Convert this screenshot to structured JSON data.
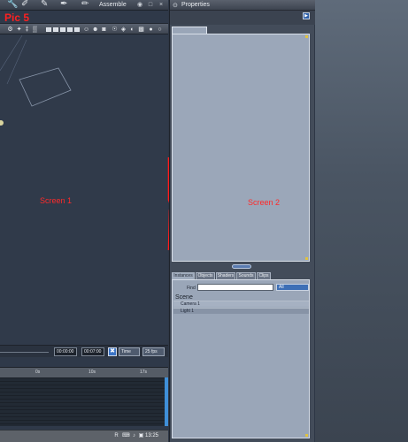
{
  "annotation": {
    "pic_label": "Pic 5",
    "screen1_label": "Screen 1",
    "screen2_label": "Screen 2",
    "color": "#ff2020"
  },
  "assemble": {
    "title": "Assemble",
    "top_icons": [
      "wrench-icon",
      "brush-icon",
      "pen-icon",
      "knife-icon",
      "pencil-icon"
    ]
  },
  "view_toolbar": {
    "icons": [
      "gear-icon",
      "joint-icon",
      "bone-icon",
      "grid-icon",
      "box-icon",
      "frame-icon",
      "wire-icon",
      "solid-icon",
      "lit-icon",
      "mask-icon",
      "face-icon",
      "camera-icon",
      "light-icon",
      "cube-icon",
      "sphere-icon",
      "texture-icon",
      "ball-icon"
    ]
  },
  "timeline": {
    "start_time": "00:00:00",
    "end_time": "00:07:00",
    "mode": "Time",
    "fps": "25 fps",
    "ticks": [
      "0s",
      "10s",
      "17s"
    ]
  },
  "status_bar": {
    "clock": "13:25"
  },
  "properties": {
    "title": "Properties",
    "accent": "#3d6fb6"
  },
  "scene": {
    "tabs": [
      "Instances",
      "Objects",
      "Shaders",
      "Sounds",
      "Clips"
    ],
    "active_tab": "Instances",
    "find_label": "Find",
    "find_value": "",
    "filter_value": "All",
    "heading": "Scene",
    "items": [
      "Camera 1",
      "Light 1"
    ]
  }
}
